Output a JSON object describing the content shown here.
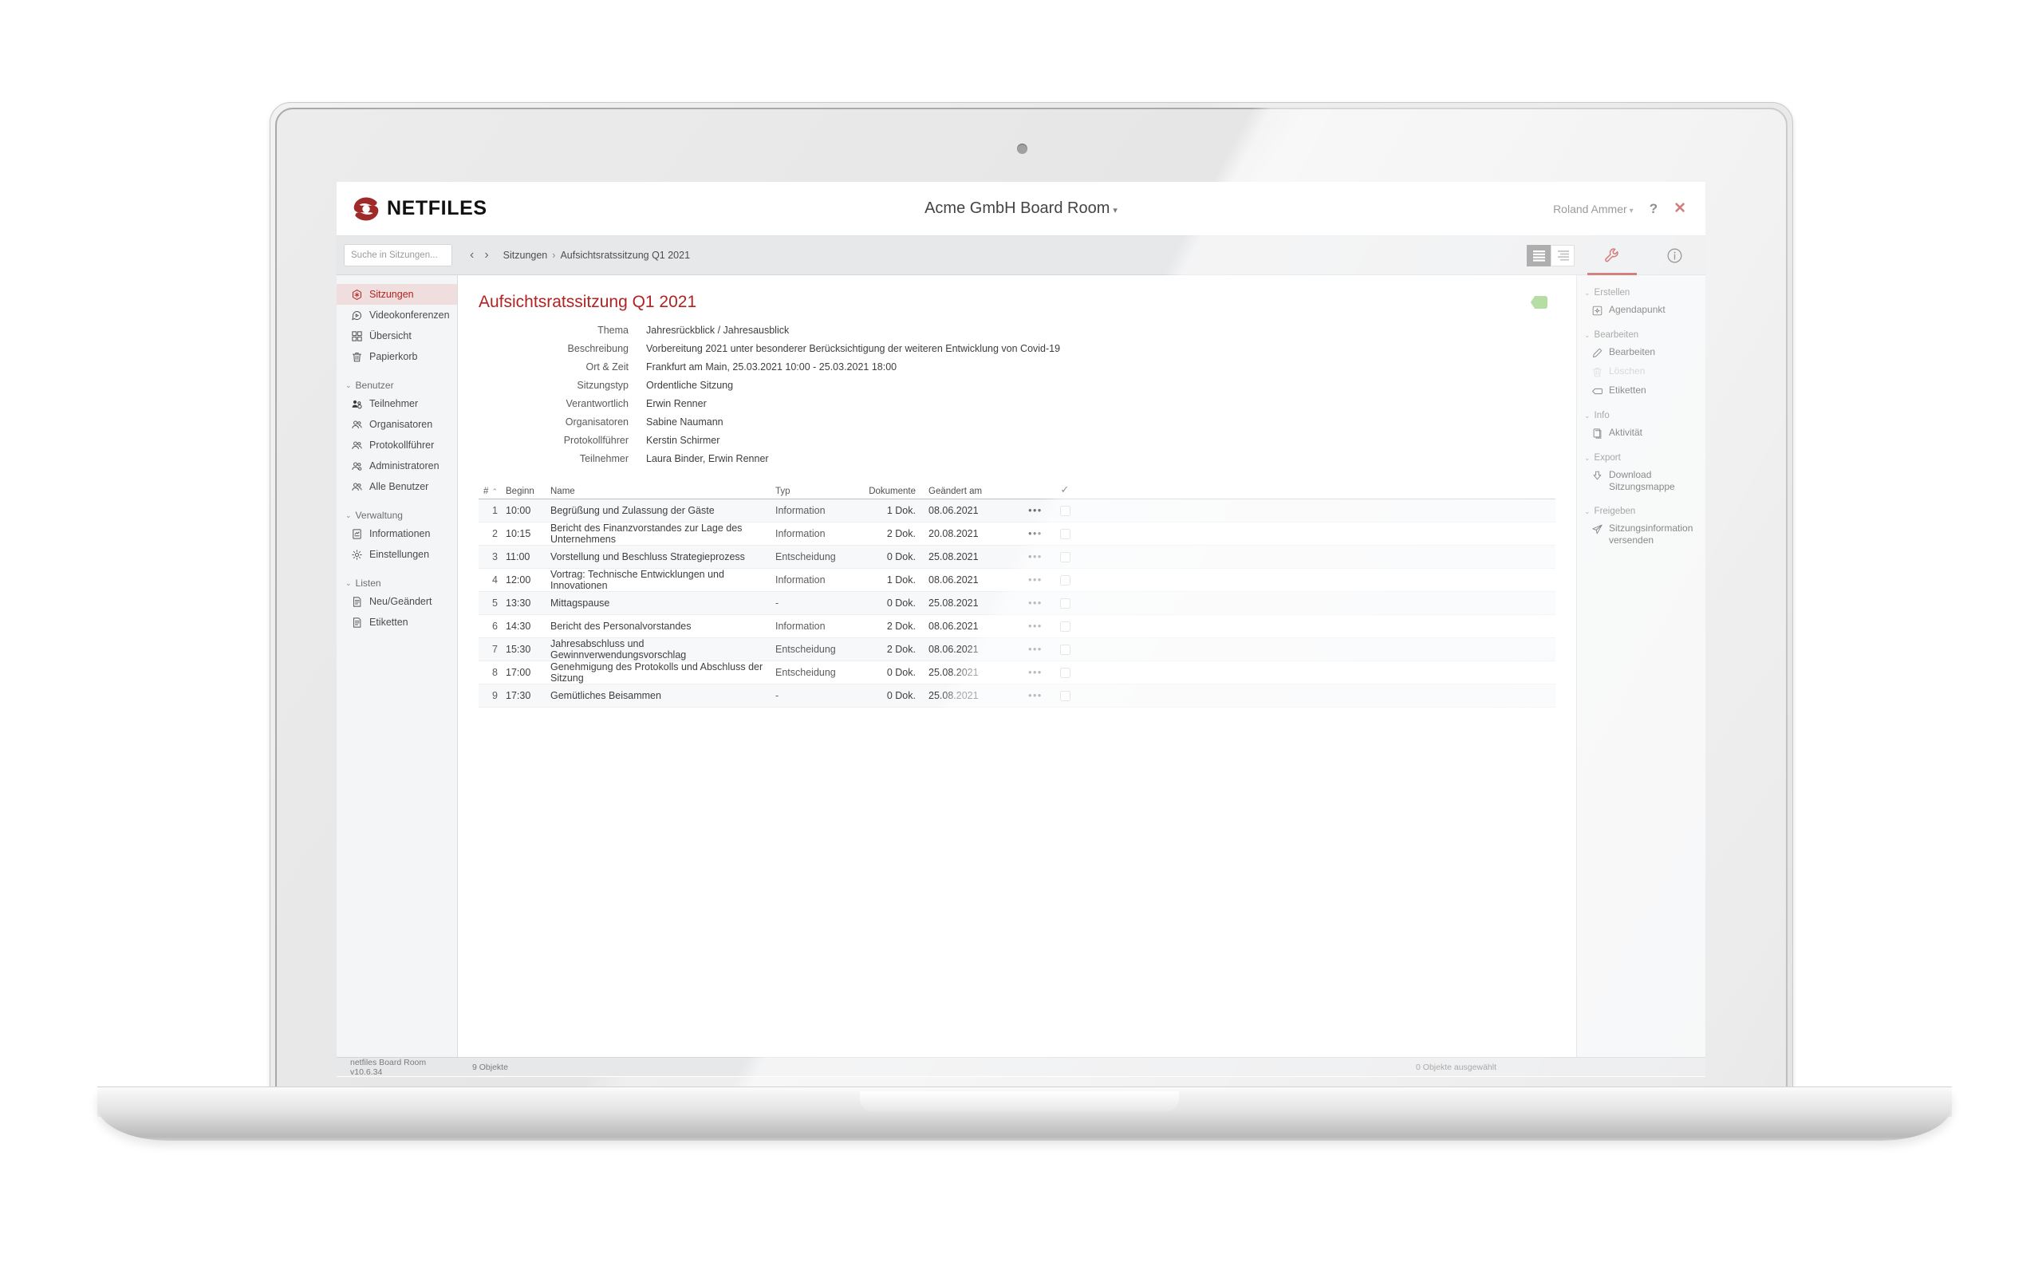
{
  "header": {
    "logo_icon": "netfiles-logo-icon",
    "logo_text": "NETFILES",
    "workspace_title": "Acme GmbH Board Room",
    "workspace_caret": "▾",
    "user_name": "Roland Ammer",
    "user_caret": "▾",
    "help_label": "?",
    "close_label": "✕"
  },
  "toolbar": {
    "search_placeholder": "Suche in Sitzungen...",
    "search_value": "",
    "back_icon": "chevron-left-icon",
    "forward_icon": "chevron-right-icon",
    "back_glyph": "‹",
    "forward_glyph": "›",
    "breadcrumb": [
      "Sitzungen",
      "Aufsichtsratssitzung Q1 2021"
    ],
    "breadcrumb_separator": "›",
    "view_list_icon": "list-view-icon",
    "view_detail_icon": "detail-view-icon",
    "tab_tools_icon": "wrench-icon",
    "tab_info_icon": "info-circle-icon"
  },
  "sidebar": {
    "items": [
      {
        "label": "Sitzungen",
        "icon": "meeting-hex-icon",
        "active": true
      },
      {
        "label": "Videokonferenzen",
        "icon": "video-chat-icon",
        "active": false
      },
      {
        "label": "Übersicht",
        "icon": "grid-overview-icon",
        "active": false
      },
      {
        "label": "Papierkorb",
        "icon": "trash-icon",
        "active": false
      }
    ],
    "groups": [
      {
        "label": "Benutzer",
        "chevron": "⌄",
        "items": [
          {
            "label": "Teilnehmer",
            "icon": "participants-icon"
          },
          {
            "label": "Organisatoren",
            "icon": "users-icon"
          },
          {
            "label": "Protokollführer",
            "icon": "users-icon"
          },
          {
            "label": "Administratoren",
            "icon": "users-gear-icon"
          },
          {
            "label": "Alle Benutzer",
            "icon": "users-icon"
          }
        ]
      },
      {
        "label": "Verwaltung",
        "chevron": "⌄",
        "items": [
          {
            "label": "Informationen",
            "icon": "document-info-icon"
          },
          {
            "label": "Einstellungen",
            "icon": "gear-icon"
          }
        ]
      },
      {
        "label": "Listen",
        "chevron": "⌄",
        "items": [
          {
            "label": "Neu/Geändert",
            "icon": "list-document-icon"
          },
          {
            "label": "Etiketten",
            "icon": "list-document-icon"
          }
        ]
      }
    ]
  },
  "page": {
    "title": "Aufsichtsratssitzung Q1 2021",
    "status_tag_icon": "label-tag-icon",
    "status_tag_color": "#7ac25c",
    "meta": [
      {
        "label": "Thema",
        "value": "Jahresrückblick / Jahresausblick"
      },
      {
        "label": "Beschreibung",
        "value": "Vorbereitung 2021 unter besonderer Berücksichtigung der weiteren Entwicklung von Covid-19"
      },
      {
        "label": "Ort & Zeit",
        "value": "Frankfurt am Main, 25.03.2021 10:00 - 25.03.2021 18:00"
      },
      {
        "label": "Sitzungstyp",
        "value": "Ordentliche Sitzung"
      },
      {
        "label": "Verantwortlich",
        "value": "Erwin Renner"
      },
      {
        "label": "Organisatoren",
        "value": "Sabine Naumann"
      },
      {
        "label": "Protokollführer",
        "value": "Kerstin Schirmer"
      },
      {
        "label": "Teilnehmer",
        "value": "Laura Binder, Erwin Renner"
      }
    ]
  },
  "agenda": {
    "columns": {
      "num": "#",
      "sort_caret": "⌃",
      "time": "Beginn",
      "name": "Name",
      "type": "Typ",
      "documents": "Dokumente",
      "modified": "Geändert am",
      "select_all_icon": "check-icon",
      "select_all_glyph": "✓"
    },
    "row_menu_glyph": "•••",
    "rows": [
      {
        "num": "1",
        "time": "10:00",
        "name": "Begrüßung und Zulassung der Gäste",
        "type": "Information",
        "documents": "1 Dok.",
        "modified": "08.06.2021"
      },
      {
        "num": "2",
        "time": "10:15",
        "name": "Bericht des Finanzvorstandes zur Lage des Unternehmens",
        "type": "Information",
        "documents": "2 Dok.",
        "modified": "20.08.2021"
      },
      {
        "num": "3",
        "time": "11:00",
        "name": "Vorstellung und Beschluss Strategieprozess",
        "type": "Entscheidung",
        "documents": "0 Dok.",
        "modified": "25.08.2021"
      },
      {
        "num": "4",
        "time": "12:00",
        "name": "Vortrag: Technische Entwicklungen und Innovationen",
        "type": "Information",
        "documents": "1 Dok.",
        "modified": "08.06.2021"
      },
      {
        "num": "5",
        "time": "13:30",
        "name": "Mittagspause",
        "type": "-",
        "documents": "0 Dok.",
        "modified": "25.08.2021"
      },
      {
        "num": "6",
        "time": "14:30",
        "name": "Bericht des Personalvorstandes",
        "type": "Information",
        "documents": "2 Dok.",
        "modified": "08.06.2021"
      },
      {
        "num": "7",
        "time": "15:30",
        "name": "Jahresabschluss und Gewinnverwendungsvorschlag",
        "type": "Entscheidung",
        "documents": "2 Dok.",
        "modified": "08.06.2021"
      },
      {
        "num": "8",
        "time": "17:00",
        "name": "Genehmigung des Protokolls und Abschluss der Sitzung",
        "type": "Entscheidung",
        "documents": "0 Dok.",
        "modified": "25.08.2021"
      },
      {
        "num": "9",
        "time": "17:30",
        "name": "Gemütliches Beisammen",
        "type": "-",
        "documents": "0 Dok.",
        "modified": "25.08.2021"
      }
    ]
  },
  "actions": {
    "groups": [
      {
        "label": "Erstellen",
        "chevron": "⌄",
        "items": [
          {
            "label": "Agendapunkt",
            "icon": "agenda-item-icon",
            "disabled": false
          }
        ]
      },
      {
        "label": "Bearbeiten",
        "chevron": "⌄",
        "items": [
          {
            "label": "Bearbeiten",
            "icon": "pencil-icon",
            "disabled": false
          },
          {
            "label": "Löschen",
            "icon": "trash-icon",
            "disabled": true
          },
          {
            "label": "Etiketten",
            "icon": "label-tag-icon",
            "disabled": false
          }
        ]
      },
      {
        "label": "Info",
        "chevron": "⌄",
        "items": [
          {
            "label": "Aktivität",
            "icon": "activity-icon",
            "disabled": false
          }
        ]
      },
      {
        "label": "Export",
        "chevron": "⌄",
        "items": [
          {
            "label": "Download Sitzungsmappe",
            "icon": "download-icon",
            "disabled": false
          }
        ]
      },
      {
        "label": "Freigeben",
        "chevron": "⌄",
        "items": [
          {
            "label": "Sitzungsinformation versenden",
            "icon": "send-paper-plane-icon",
            "disabled": false
          }
        ]
      }
    ]
  },
  "status_bar": {
    "version": "netfiles Board Room v10.6.34",
    "object_count": "9 Objekte",
    "selected_count": "0 Objekte ausgewählt"
  },
  "colors": {
    "brand_red": "#b22222",
    "accent_green": "#7ac25c",
    "chrome_gray": "#e7e8ea",
    "panel_gray": "#f4f5f6"
  }
}
